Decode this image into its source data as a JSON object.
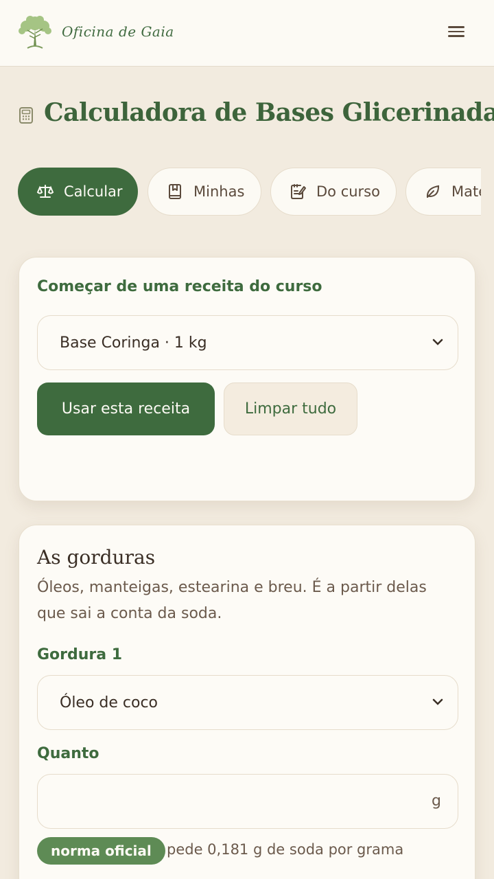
{
  "header": {
    "brand": "Oficina de Gaia",
    "logo_icon": "tree-logo-icon",
    "menu_icon": "hamburger-menu-icon"
  },
  "page": {
    "title": "Calculadora de Bases Glicerinadas",
    "title_icon": "calculator-icon"
  },
  "tabs": [
    {
      "label": "Calcular",
      "icon": "scale-icon",
      "active": true
    },
    {
      "label": "Minhas",
      "icon": "bookmark-book-icon",
      "active": false
    },
    {
      "label": "Do curso",
      "icon": "notebook-edit-icon",
      "active": false
    },
    {
      "label": "Mate",
      "icon": "leaf-icon",
      "active": false
    }
  ],
  "recipe_card": {
    "label": "Começar de uma receita do curso",
    "selected": "Base Coringa · 1 kg",
    "use_button": "Usar esta receita",
    "clear_button": "Limpar tudo"
  },
  "fats_card": {
    "title": "As gorduras",
    "description": "Óleos, manteigas, estearina e breu. É a partir delas que sai a conta da soda.",
    "fat_label": "Gordura 1",
    "fat_selected": "Óleo de coco",
    "amount_label": "Quanto",
    "amount_value": "",
    "amount_unit": "g",
    "badge": "norma oficial",
    "badge_note": "pede 0,181 g de soda por grama"
  },
  "colors": {
    "primary_green": "#3e6b3e",
    "badge_green": "#5e8b55",
    "background": "#f2ebdf",
    "card": "#fdfbf6"
  }
}
